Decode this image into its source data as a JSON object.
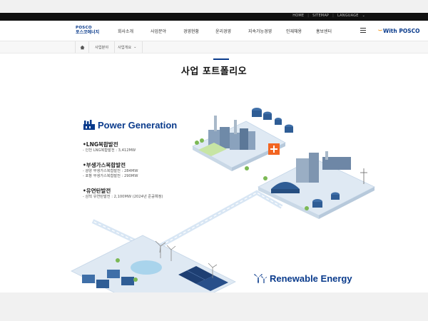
{
  "topbar": {
    "links": [
      "HOME",
      "SITEMAP",
      "LANGUAGE"
    ]
  },
  "header": {
    "logo_en": "POSCO",
    "logo_ko": "포스코에너지",
    "nav": [
      "회사소개",
      "사업분야",
      "경영현황",
      "윤리경영",
      "지속가능경영",
      "인재채용",
      "홍보센터"
    ],
    "brand": "With POSCO"
  },
  "breadcrumb": {
    "level1": "사업분야",
    "level2": "사업개요"
  },
  "page_title": "사업 포트폴리오",
  "power": {
    "heading": "Power Generation",
    "items": [
      {
        "title": "•LNG복합발전",
        "details": [
          "- 인천 LNG복합발전 : 3,412MW"
        ]
      },
      {
        "title": "•부생가스복합발전",
        "details": [
          "- 광양 부생가스복합발전 : 284MW",
          "- 포항 부생가스복합발전 : 290MW"
        ]
      },
      {
        "title": "•유연탄발전",
        "details": [
          "- 삼척 유연탄발전 : 2,100MW (2024년 준공예정)"
        ]
      }
    ]
  },
  "renewable": {
    "heading": "Renewable Energy"
  },
  "colors": {
    "brand_blue": "#0a3b8c",
    "accent_orange": "#f26522",
    "topbar": "#111111"
  }
}
